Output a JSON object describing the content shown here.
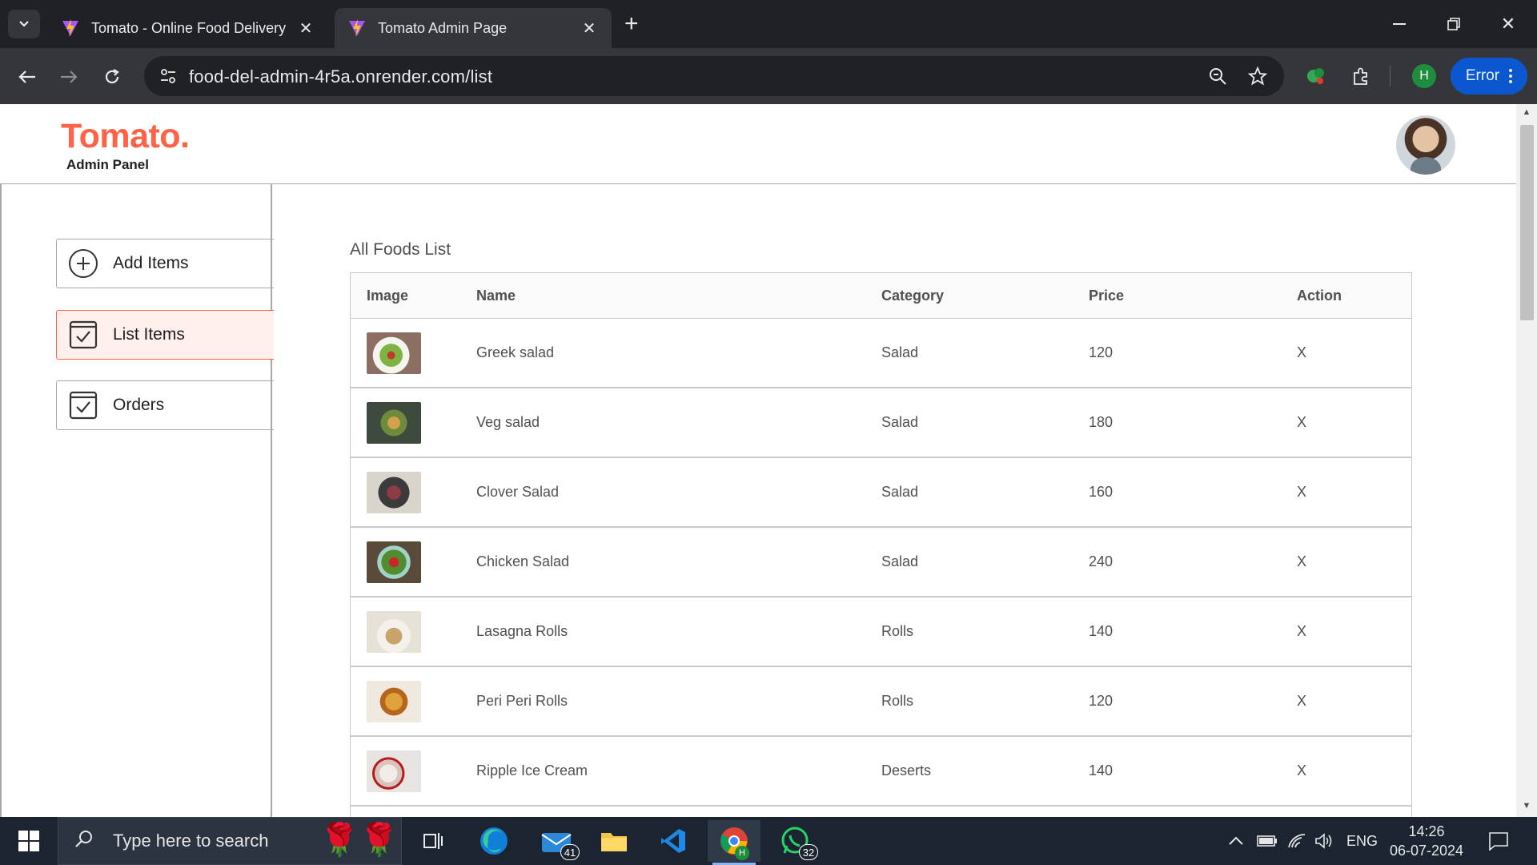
{
  "browser": {
    "tabs": [
      {
        "title": "Tomato - Online Food Delivery",
        "active": false
      },
      {
        "title": "Tomato Admin Page",
        "active": true
      }
    ],
    "url": "food-del-admin-4r5a.onrender.com/list",
    "profile_initial": "H",
    "error_label": "Error"
  },
  "app": {
    "logo": "Tomato.",
    "logo_subtitle": "Admin Panel",
    "brand_color": "#ff6347"
  },
  "sidebar": {
    "items": [
      {
        "label": "Add Items",
        "icon": "plus-circle-icon",
        "active": false
      },
      {
        "label": "List Items",
        "icon": "checkbox-icon",
        "active": true
      },
      {
        "label": "Orders",
        "icon": "checkbox-icon",
        "active": false
      }
    ]
  },
  "list": {
    "title": "All Foods List",
    "columns": [
      "Image",
      "Name",
      "Category",
      "Price",
      "Action"
    ],
    "rows": [
      {
        "name": "Greek salad",
        "category": "Salad",
        "price": "120",
        "action": "X"
      },
      {
        "name": "Veg salad",
        "category": "Salad",
        "price": "180",
        "action": "X"
      },
      {
        "name": "Clover Salad",
        "category": "Salad",
        "price": "160",
        "action": "X"
      },
      {
        "name": "Chicken Salad",
        "category": "Salad",
        "price": "240",
        "action": "X"
      },
      {
        "name": "Lasagna Rolls",
        "category": "Rolls",
        "price": "140",
        "action": "X"
      },
      {
        "name": "Peri Peri Rolls",
        "category": "Rolls",
        "price": "120",
        "action": "X"
      },
      {
        "name": "Ripple Ice Cream",
        "category": "Deserts",
        "price": "140",
        "action": "X"
      }
    ]
  },
  "taskbar": {
    "search_placeholder": "Type here to search",
    "mail_badge": "41",
    "whatsapp_badge": "32",
    "chrome_badge": "H",
    "language": "ENG",
    "time": "14:26",
    "date": "06-07-2024"
  }
}
